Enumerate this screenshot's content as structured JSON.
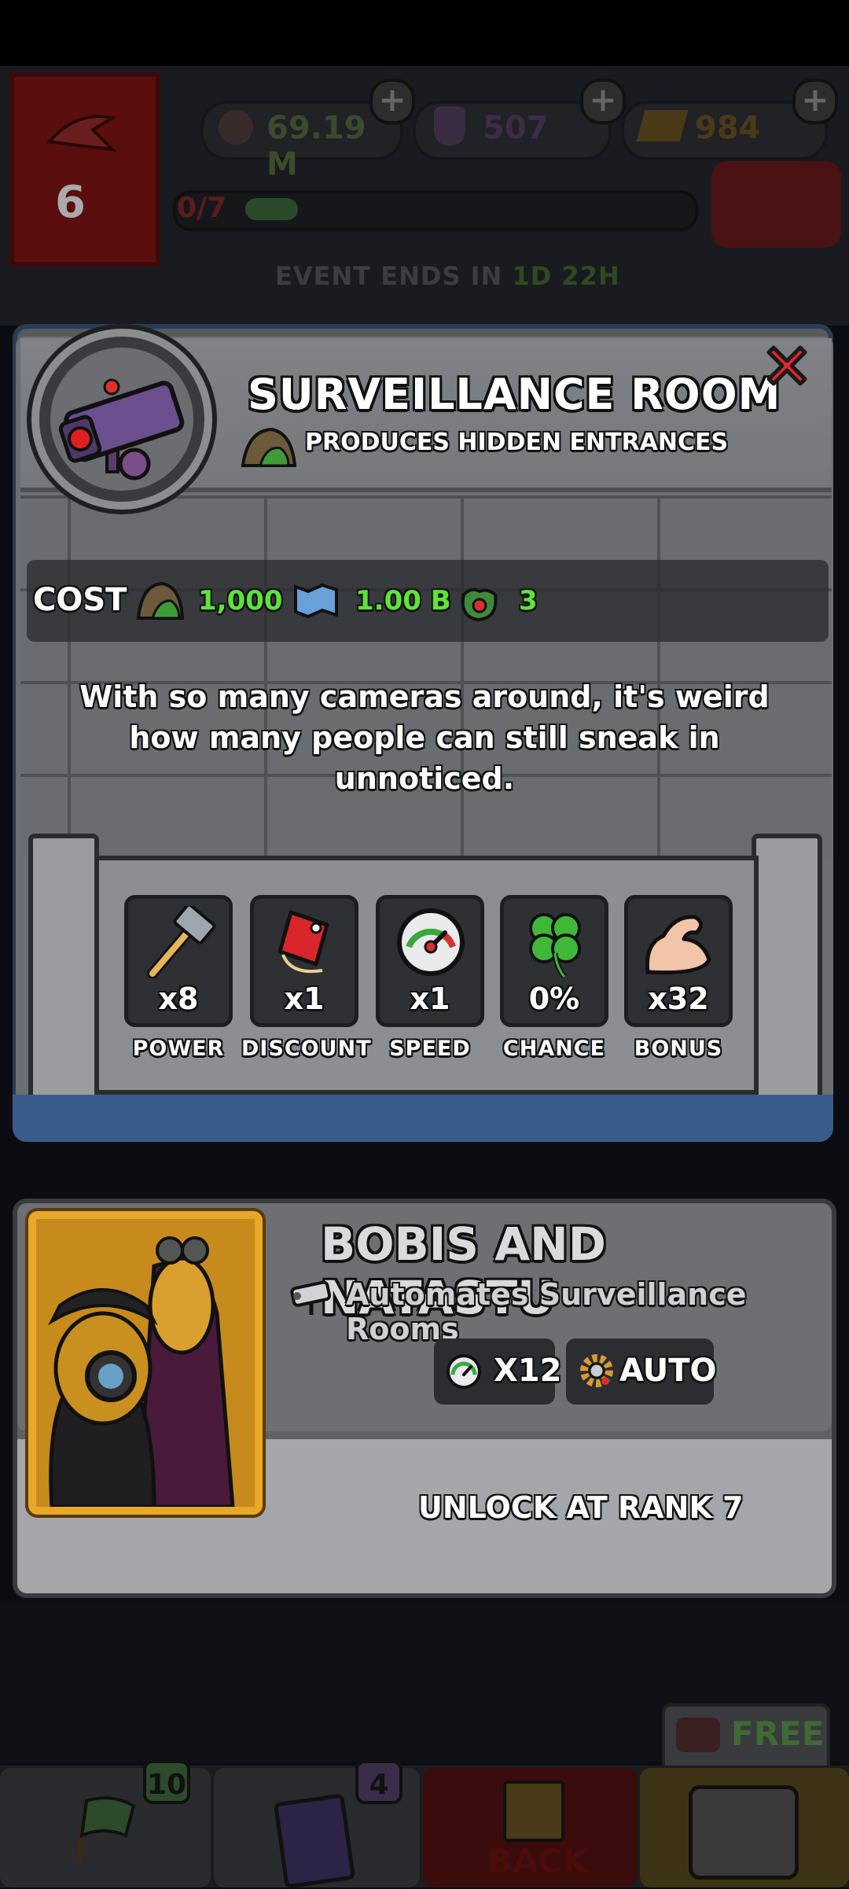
{
  "top_bar": {
    "rank": "6",
    "cash": "69.19 M",
    "potion": "507",
    "gold": "984",
    "progress": "0/7",
    "progress_fraction": 0.12,
    "event_label": "EVENT ENDS IN",
    "event_time": "1D 22H"
  },
  "modal": {
    "title": "SURVEILLANCE ROOM",
    "subtitle": "PRODUCES HIDDEN ENTRANCES",
    "cost_label": "COST",
    "costs": [
      {
        "icon": "rock-resource-icon",
        "value": "1,000"
      },
      {
        "icon": "map-scroll-icon",
        "value": "1.00 B"
      },
      {
        "icon": "cash-bag-icon",
        "value": "3"
      }
    ],
    "description": "With so many cameras around, it's weird how many people can still sneak in unnoticed.",
    "stats": [
      {
        "icon": "hammer-icon",
        "value": "x8",
        "label": "POWER"
      },
      {
        "icon": "price-tag-icon",
        "value": "x1",
        "label": "DISCOUNT"
      },
      {
        "icon": "speedometer-icon",
        "value": "x1",
        "label": "SPEED"
      },
      {
        "icon": "clover-icon",
        "value": "0%",
        "label": "CHANCE"
      },
      {
        "icon": "flexed-arm-icon",
        "value": "x32",
        "label": "BONUS"
      }
    ]
  },
  "manager": {
    "name": "BOBIS AND NATASTU",
    "description": "Automates Surveillance Rooms",
    "speed_value": "X12",
    "auto_label": "AUTO",
    "unlock_text": "UNLOCK AT RANK 7"
  },
  "bottom_nav": {
    "missions_badge": "10",
    "cards_badge": "4",
    "back_label": "BACK",
    "free_label": "FREE"
  },
  "colors": {
    "cost_green": "#5ee33a",
    "gold_frame": "#e7a72a",
    "close_red": "#e8262a"
  }
}
